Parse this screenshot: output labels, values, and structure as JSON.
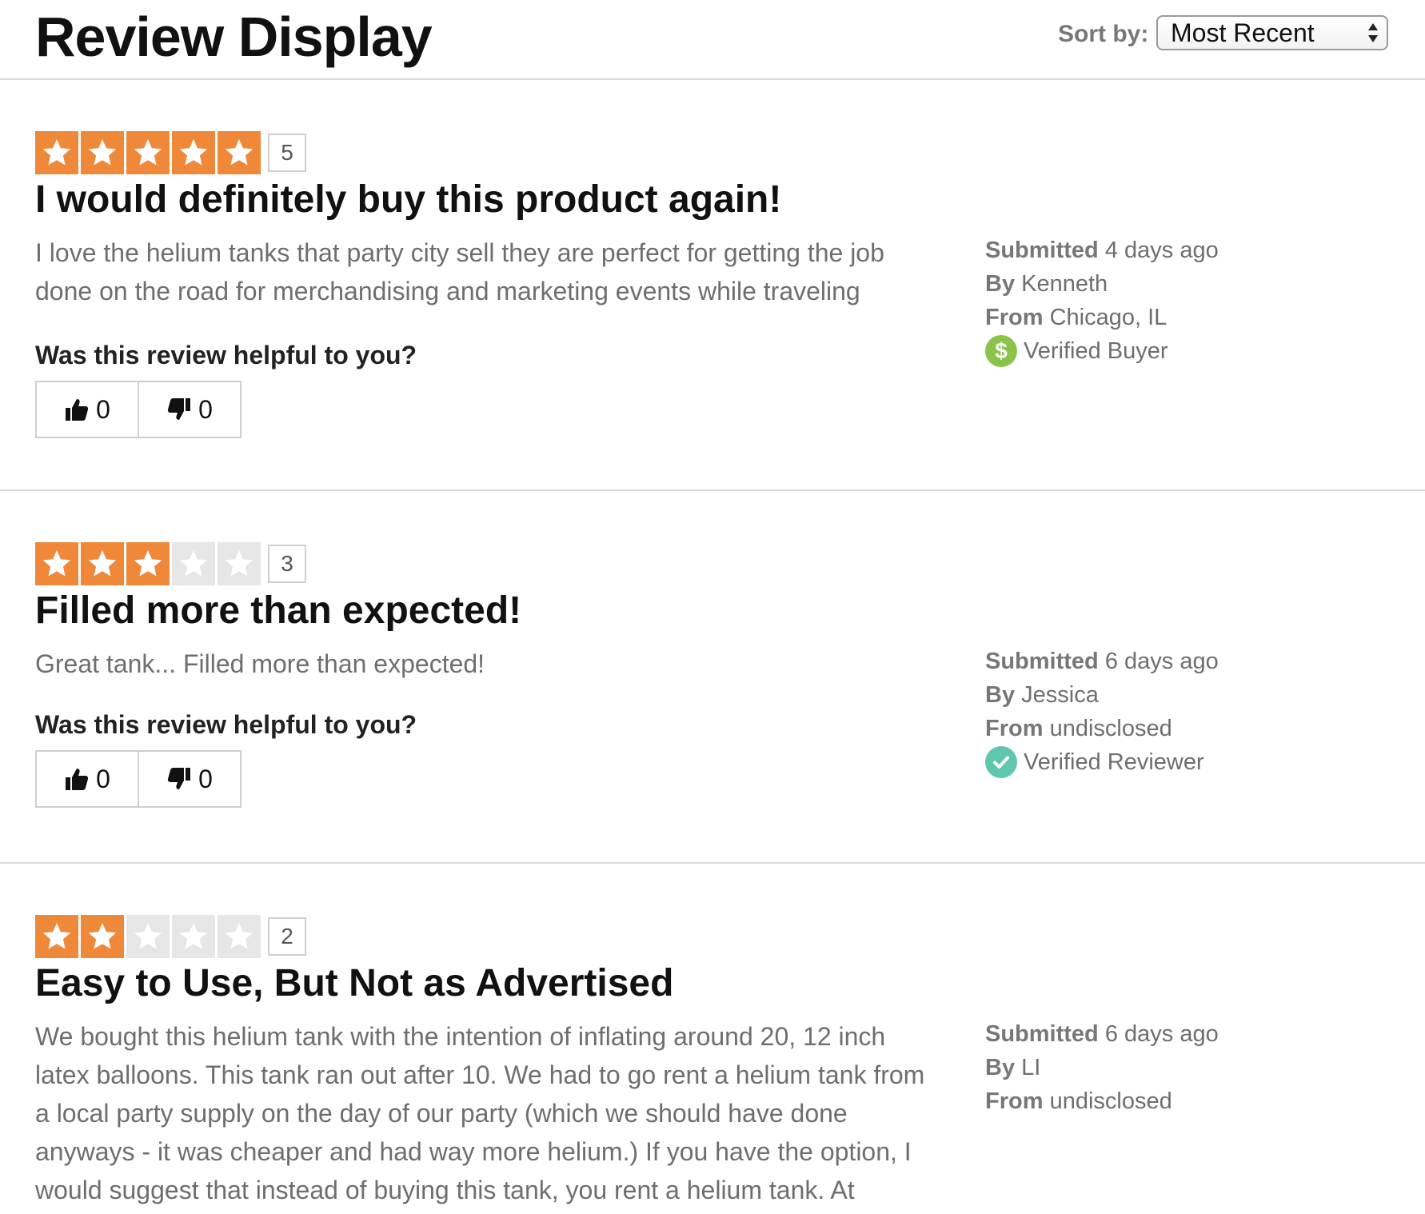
{
  "header": {
    "title": "Review Display",
    "sort_label": "Sort by:",
    "sort_value": "Most Recent"
  },
  "helpful_question": "Was this review helpful to you?",
  "colors": {
    "star_on": "#f0883a",
    "star_off": "#e6e6e6",
    "verified_buyer": "#8bc34a",
    "verified_reviewer": "#5fc7ad"
  },
  "reviews": [
    {
      "rating": 5,
      "rating_label": "5",
      "title": "I would definitely buy this product again!",
      "body": "I love the helium tanks that party city sell they are perfect for getting the job done on the road for merchandising and marketing events while traveling",
      "helpful_up": "0",
      "helpful_down": "0",
      "submitted_label": "Submitted",
      "submitted": "4 days ago",
      "by_label": "By",
      "by": "Kenneth",
      "from_label": "From",
      "from": "Chicago, IL",
      "badge": "Verified Buyer",
      "badge_icon": "dollar-icon"
    },
    {
      "rating": 3,
      "rating_label": "3",
      "title": "Filled more than expected!",
      "body": "Great tank... Filled more than expected!",
      "helpful_up": "0",
      "helpful_down": "0",
      "submitted_label": "Submitted",
      "submitted": "6 days ago",
      "by_label": "By",
      "by": "Jessica",
      "from_label": "From",
      "from": "undisclosed",
      "badge": "Verified Reviewer",
      "badge_icon": "checkmark-icon"
    },
    {
      "rating": 2,
      "rating_label": "2",
      "title": "Easy to Use, But Not as Advertised",
      "body": "We bought this helium tank with the intention of inflating around 20, 12 inch latex balloons. This tank ran out after 10. We had to go rent a helium tank from a local party supply on the day of our party (which we should have done anyways - it was cheaper and had way more helium.) If you have the option, I would suggest that instead of buying this tank, you rent a helium tank. At",
      "submitted_label": "Submitted",
      "submitted": "6 days ago",
      "by_label": "By",
      "by": "LI",
      "from_label": "From",
      "from": "undisclosed"
    }
  ]
}
